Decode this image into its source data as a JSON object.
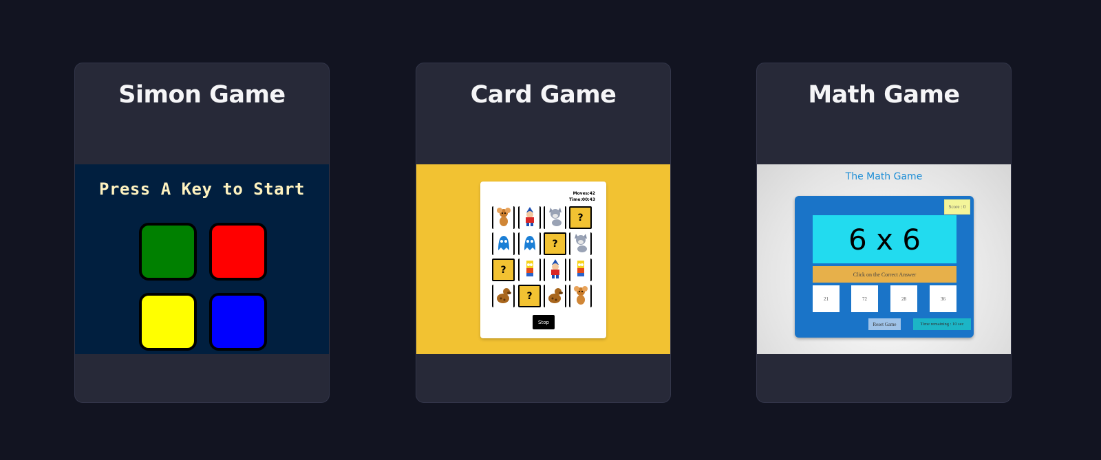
{
  "cards": [
    {
      "title": "Simon Game"
    },
    {
      "title": "Card Game"
    },
    {
      "title": "Math Game"
    }
  ],
  "simon": {
    "prompt": "Press A Key to Start",
    "buttons": [
      {
        "color": "#008000"
      },
      {
        "color": "#ff0000"
      },
      {
        "color": "#ffff00"
      },
      {
        "color": "#0000ff"
      }
    ]
  },
  "card_game": {
    "moves": "Moves:42",
    "time": "Time:00:43",
    "unrevealed": "?",
    "stop_label": "Stop",
    "tiles": [
      "jerry",
      "noddy",
      "tom",
      "?",
      "ghost",
      "ghost",
      "?",
      "tom",
      "?",
      "bart",
      "noddy",
      "bart",
      "scooby",
      "?",
      "scooby",
      "jerry"
    ]
  },
  "math_game": {
    "title": "The Math Game",
    "score": "Score : 0",
    "question": "6 x 6",
    "instruction": "Click on the Correct Answer",
    "choices": [
      "21",
      "72",
      "28",
      "36"
    ],
    "reset_label": "Reset Game",
    "time_remaining": "Time remaining : 10 sec"
  },
  "colors": {
    "page_bg": "#121421",
    "card_bg": "#272938",
    "card_game_bg": "#f2c232",
    "simon_bg": "#011f3f"
  }
}
